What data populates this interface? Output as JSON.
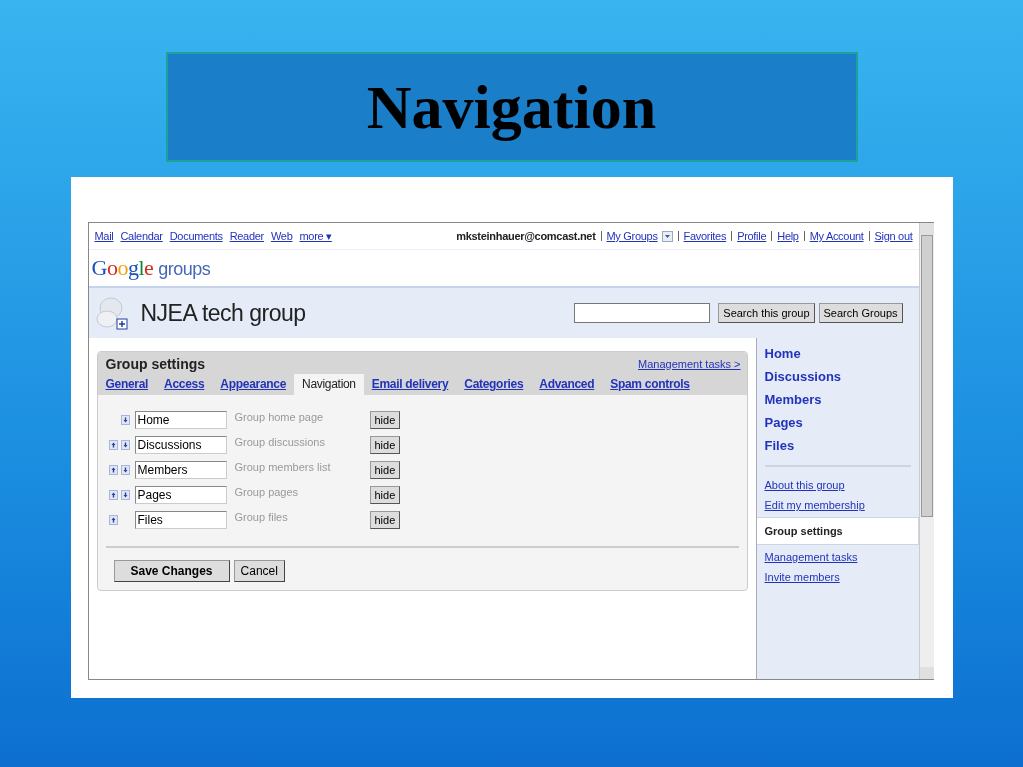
{
  "slide": {
    "title": "Navigation"
  },
  "top_bar": {
    "links": [
      "Mail",
      "Calendar",
      "Documents",
      "Reader",
      "Web",
      "more ▾"
    ],
    "user": "mksteinhauer@comcast.net",
    "account_links": [
      "My Groups",
      "Favorites",
      "Profile",
      "Help",
      "My Account",
      "Sign out"
    ]
  },
  "logo": {
    "brand": "Google",
    "product": "groups"
  },
  "group": {
    "name": "NJEA tech group",
    "buttons": [
      "Search this group",
      "Search Groups"
    ]
  },
  "settings": {
    "title": "Group settings",
    "management_link": "Management tasks >",
    "tabs": [
      {
        "label": "General",
        "selected": false
      },
      {
        "label": "Access",
        "selected": false
      },
      {
        "label": "Appearance",
        "selected": false
      },
      {
        "label": "Navigation",
        "selected": true
      },
      {
        "label": "Email delivery",
        "selected": false
      },
      {
        "label": "Categories",
        "selected": false
      },
      {
        "label": "Advanced",
        "selected": false
      },
      {
        "label": "Spam controls",
        "selected": false
      }
    ],
    "rows": [
      {
        "name": "Home",
        "description": "Group home page",
        "button": "hide",
        "can_move_up": false,
        "can_move_down": true
      },
      {
        "name": "Discussions",
        "description": "Group discussions",
        "button": "hide",
        "can_move_up": true,
        "can_move_down": true
      },
      {
        "name": "Members",
        "description": "Group members list",
        "button": "hide",
        "can_move_up": true,
        "can_move_down": true
      },
      {
        "name": "Pages",
        "description": "Group pages",
        "button": "hide",
        "can_move_up": true,
        "can_move_down": true
      },
      {
        "name": "Files",
        "description": "Group files",
        "button": "hide",
        "can_move_up": true,
        "can_move_down": false
      }
    ],
    "buttons": [
      "Save Changes",
      "Cancel"
    ]
  },
  "sidebar": {
    "items": [
      {
        "label": "Home",
        "kind": "main",
        "selected": false
      },
      {
        "label": "Discussions",
        "kind": "main",
        "selected": false
      },
      {
        "label": "Members",
        "kind": "main",
        "selected": false
      },
      {
        "label": "Pages",
        "kind": "main",
        "selected": false
      },
      {
        "label": "Files",
        "kind": "main",
        "selected": false
      },
      {
        "label": "About this group",
        "kind": "link",
        "selected": false
      },
      {
        "label": "Edit my membership",
        "kind": "link",
        "selected": false
      },
      {
        "label": "Group settings",
        "kind": "link",
        "selected": true
      },
      {
        "label": "Management tasks",
        "kind": "link",
        "selected": false
      },
      {
        "label": "Invite members",
        "kind": "link",
        "selected": false
      }
    ]
  }
}
